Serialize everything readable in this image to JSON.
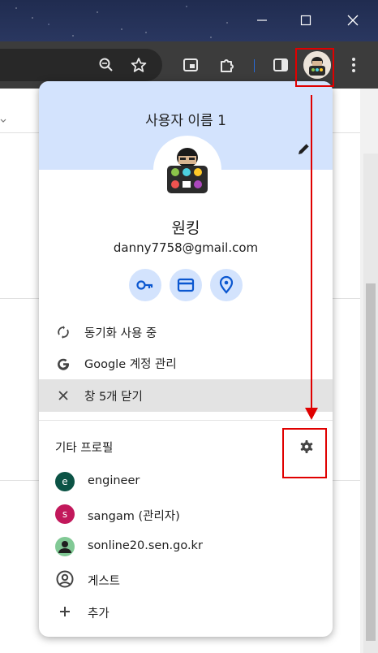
{
  "profile_panel": {
    "profile_title": "사용자 이름 1",
    "name": "원킹",
    "email": "danny7758@gmail.com",
    "menu": [
      {
        "label": "동기화 사용 중",
        "icon": "sync-icon"
      },
      {
        "label": "Google 계정 관리",
        "icon": "google-g-icon"
      },
      {
        "label": "창 5개 닫기",
        "icon": "close-icon"
      }
    ],
    "other_profiles_title": "기타 프로필",
    "profiles": [
      {
        "initial": "e",
        "label": "engineer",
        "color": "#0b5345"
      },
      {
        "initial": "s",
        "label": "sangam (관리자)",
        "color": "#c2185b"
      },
      {
        "initial": "",
        "label": "sonline20.sen.go.kr",
        "color": "#81c995"
      }
    ],
    "guest_label": "게스트",
    "add_label": "추가"
  },
  "colors": {
    "header_bg": "#d3e3fd",
    "accent": "#0b57d0",
    "annotation": "#e00000"
  }
}
